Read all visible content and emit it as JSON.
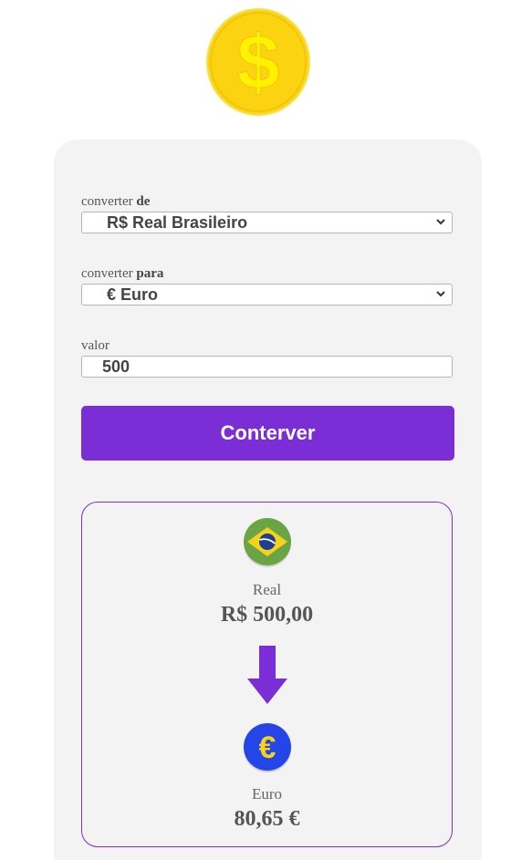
{
  "logo": {
    "icon": "dollar-coin-icon",
    "symbol": "$"
  },
  "form": {
    "from_label_prefix": "converter",
    "from_label_strong": "de",
    "from_selected": "R$ Real Brasileiro",
    "to_label_prefix": "converter",
    "to_label_strong": "para",
    "to_selected": "€ Euro",
    "value_label": "valor",
    "value": "500",
    "convert_button": "Conterver"
  },
  "result": {
    "from_icon": "brazil-flag-icon",
    "from_name": "Real",
    "from_value": "R$ 500,00",
    "arrow_icon": "arrow-down-icon",
    "to_icon": "euro-coin-icon",
    "to_symbol": "€",
    "to_name": "Euro",
    "to_value": "80,65 €"
  },
  "colors": {
    "accent": "#7b2ed6",
    "card_bg": "#f3f3f3",
    "coin_gold": "#fbd311",
    "euro_blue": "#2446e8"
  }
}
